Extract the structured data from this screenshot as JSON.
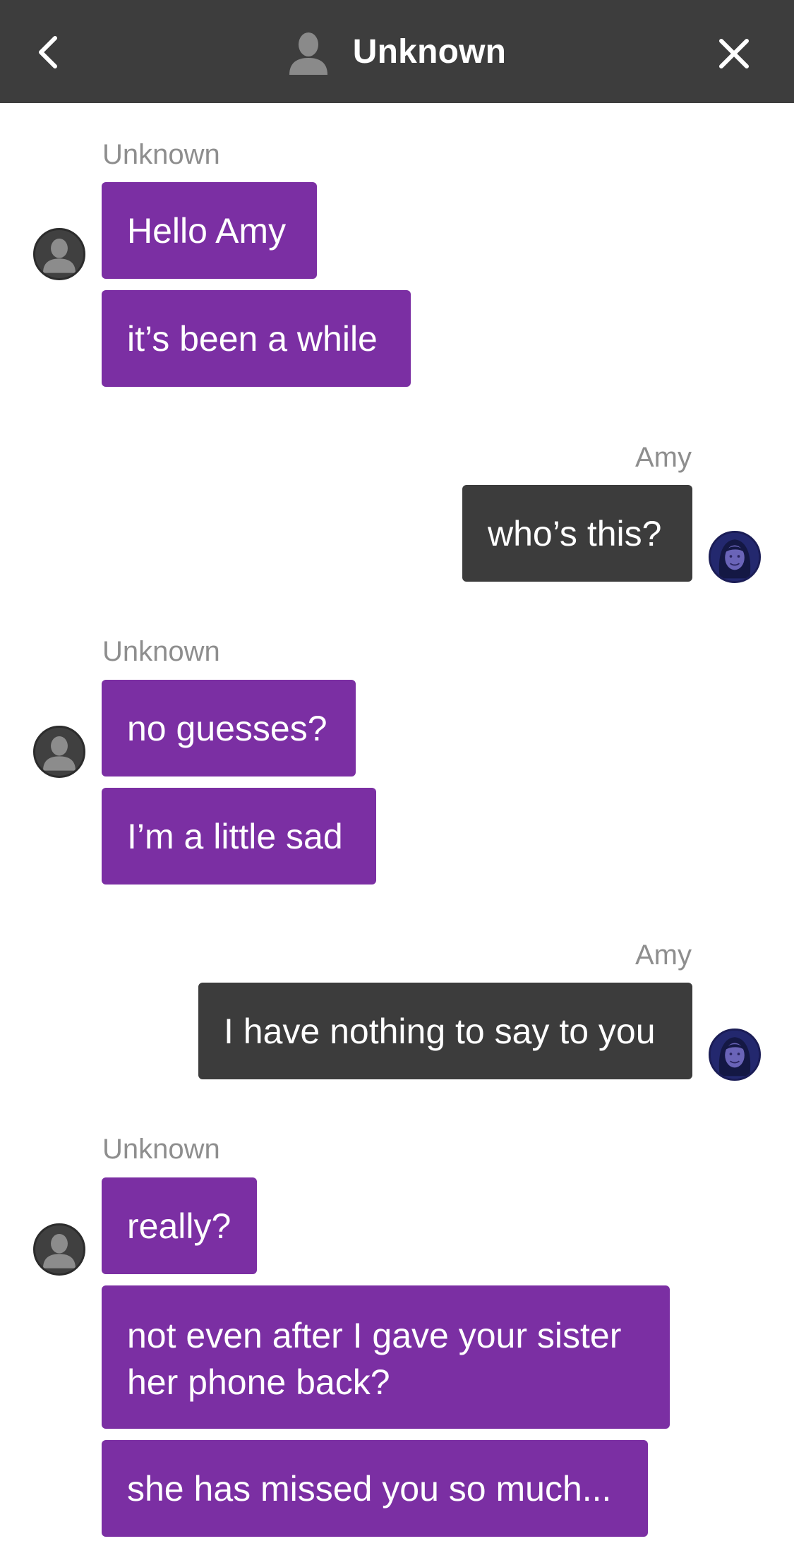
{
  "header": {
    "title": "Unknown",
    "back_icon": "chevron-left-icon",
    "close_icon": "close-icon",
    "contact_icon": "person-silhouette-icon"
  },
  "colors": {
    "header_bg": "#3d3d3d",
    "incoming_bubble": "#7b2fa3",
    "outgoing_bubble": "#3c3c3c",
    "sender_label": "#8e8e8e"
  },
  "messages": [
    {
      "sender": "Unknown",
      "lines": [
        "Hello Amy",
        "it’s been a while"
      ]
    },
    {
      "sender": "Amy",
      "lines": [
        "who’s this?"
      ]
    },
    {
      "sender": "Unknown",
      "lines": [
        "no guesses?",
        "I’m a little sad"
      ]
    },
    {
      "sender": "Amy",
      "lines": [
        "I have nothing to say to you"
      ]
    },
    {
      "sender": "Unknown",
      "lines": [
        "really?",
        "not even after I gave your sister her phone back?",
        "she has missed you so much..."
      ]
    }
  ]
}
